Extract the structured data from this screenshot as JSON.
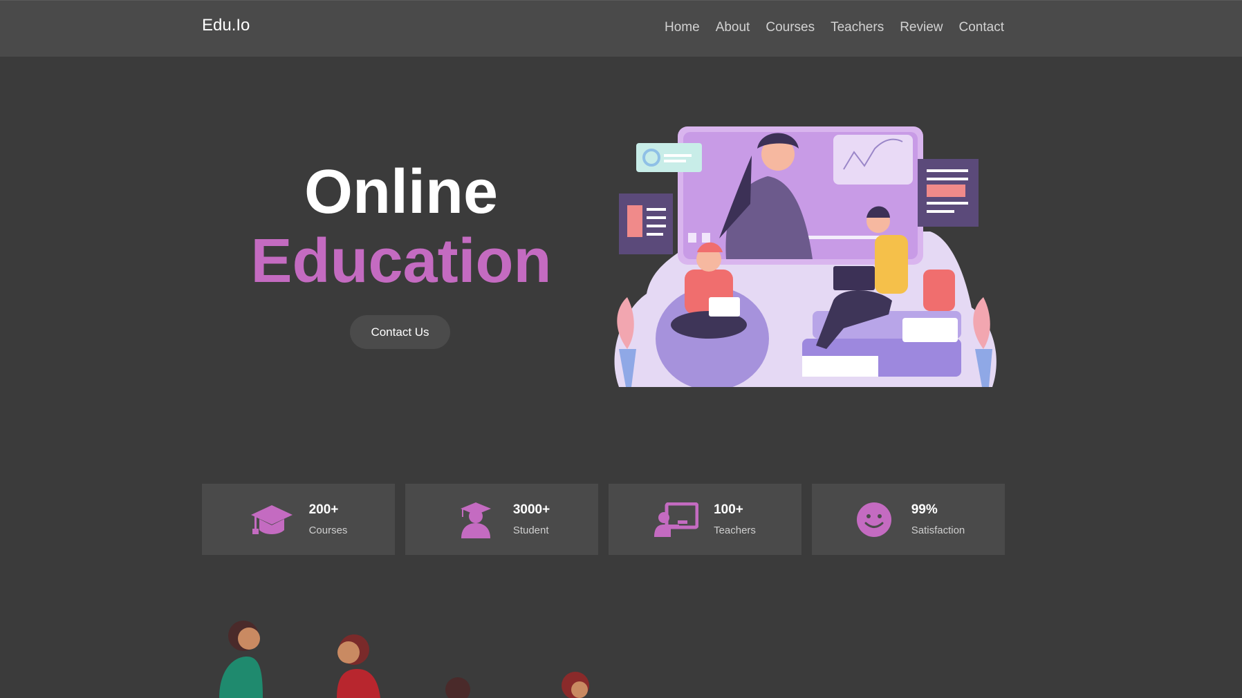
{
  "header": {
    "brand": "Edu.Io",
    "nav": [
      "Home",
      "About",
      "Courses",
      "Teachers",
      "Review",
      "Contact"
    ]
  },
  "hero": {
    "title_line1": "Online",
    "title_line2": "Education",
    "cta_label": "Contact Us",
    "accent_color": "#c46bc1"
  },
  "stats": [
    {
      "value": "200+",
      "label": "Courses",
      "icon": "graduation-cap-icon"
    },
    {
      "value": "3000+",
      "label": "Student",
      "icon": "graduate-student-icon"
    },
    {
      "value": "100+",
      "label": "Teachers",
      "icon": "teacher-board-icon"
    },
    {
      "value": "99%",
      "label": "Satisfaction",
      "icon": "smiley-icon"
    }
  ]
}
